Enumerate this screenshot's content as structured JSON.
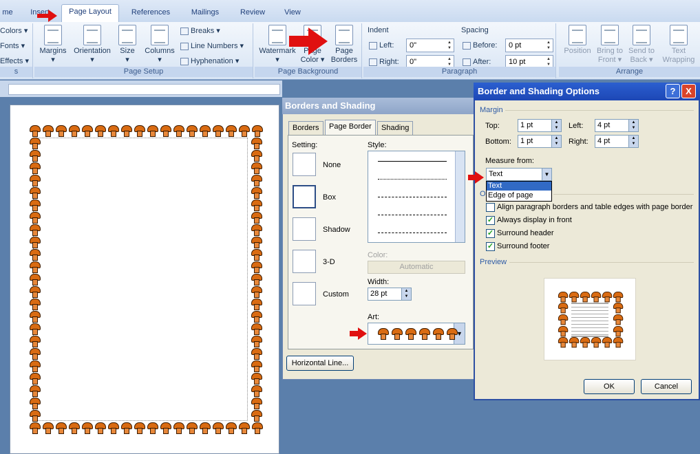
{
  "tabs": [
    "me",
    "Insert",
    "Page Layout",
    "References",
    "Mailings",
    "Review",
    "View"
  ],
  "ribbon": {
    "themes": {
      "colors": "Colors",
      "fonts": "Fonts",
      "effects": "Effects",
      "label": "s"
    },
    "page_setup": {
      "margins": "Margins",
      "orientation": "Orientation",
      "size": "Size",
      "columns": "Columns",
      "breaks": "Breaks",
      "line_numbers": "Line Numbers",
      "hyphenation": "Hyphenation",
      "label": "Page Setup"
    },
    "page_background": {
      "watermark": "Watermark",
      "page_color_1": "Page",
      "page_color_2": "Color",
      "page_borders_1": "Page",
      "page_borders_2": "Borders",
      "label": "Page Background"
    },
    "paragraph": {
      "indent": "Indent",
      "left_label": "Left:",
      "left_value": "0\"",
      "right_label": "Right:",
      "right_value": "0\"",
      "spacing": "Spacing",
      "before_label": "Before:",
      "before_value": "0 pt",
      "after_label": "After:",
      "after_value": "10 pt",
      "label": "Paragraph"
    },
    "arrange": {
      "position": "Position",
      "bring_1": "Bring to",
      "bring_2": "Front",
      "send_1": "Send to",
      "send_2": "Back",
      "text_1": "Text",
      "text_2": "Wrapping",
      "label": "Arrange"
    }
  },
  "borders_dialog": {
    "title": "Borders and Shading",
    "tabs": [
      "Borders",
      "Page Border",
      "Shading"
    ],
    "setting_label": "Setting:",
    "settings": [
      "None",
      "Box",
      "Shadow",
      "3-D",
      "Custom"
    ],
    "style_label": "Style:",
    "color_label": "Color:",
    "color_value": "Automatic",
    "width_label": "Width:",
    "width_value": "28 pt",
    "art_label": "Art:",
    "horizontal_line": "Horizontal Line..."
  },
  "options_dialog": {
    "title": "Border and Shading Options",
    "help": "?",
    "close": "X",
    "margin_label": "Margin",
    "top_label": "Top:",
    "top_value": "1 pt",
    "left_label": "Left:",
    "left_value": "4 pt",
    "bottom_label": "Bottom:",
    "bottom_value": "1 pt",
    "right_label": "Right:",
    "right_value": "4 pt",
    "measure_label": "Measure from:",
    "measure_value": "Text",
    "measure_options": [
      "Text",
      "Edge of page"
    ],
    "options_label": "O",
    "checks": [
      {
        "label": "Align paragraph borders and table edges with page border",
        "checked": false
      },
      {
        "label": "Always display in front",
        "checked": true
      },
      {
        "label": "Surround header",
        "checked": true
      },
      {
        "label": "Surround footer",
        "checked": true
      }
    ],
    "preview_label": "Preview",
    "ok": "OK",
    "cancel": "Cancel"
  },
  "colors": {
    "accent_red": "#e01010",
    "mushroom": "#d96b12",
    "title_blue": "#1d47b5"
  }
}
